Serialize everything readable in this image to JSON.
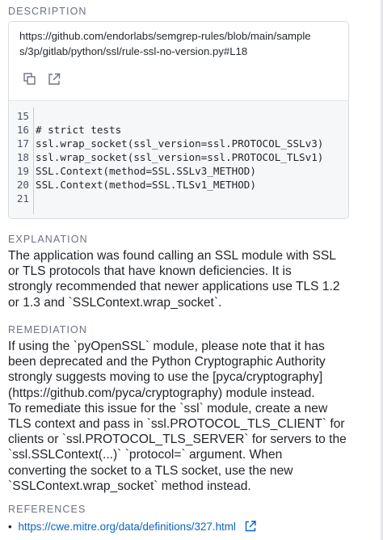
{
  "description": {
    "heading": "DESCRIPTION",
    "url_lines": [
      "https://github.com/endorlabs/semgrep-rules/blob/main/sample",
      "s/3p/gitlab/python/ssl/rule-ssl-no-version.py#L18"
    ],
    "actions": {
      "copy_icon": "copy-icon",
      "open_icon": "external-link-icon"
    },
    "code_lines": [
      {
        "no": "15",
        "code": ""
      },
      {
        "no": "16",
        "code": "# strict tests"
      },
      {
        "no": "17",
        "code": "ssl.wrap_socket(ssl_version=ssl.PROTOCOL_SSLv3)"
      },
      {
        "no": "18",
        "code": "ssl.wrap_socket(ssl_version=ssl.PROTOCOL_TLSv1)"
      },
      {
        "no": "19",
        "code": "SSL.Context(method=SSL.SSLv3_METHOD)"
      },
      {
        "no": "20",
        "code": "SSL.Context(method=SSL.TLSv1_METHOD)"
      },
      {
        "no": "21",
        "code": ""
      }
    ]
  },
  "explanation": {
    "heading": "EXPLANATION",
    "lines": [
      "The application was found calling an SSL module with SSL",
      "or TLS protocols that have known deficiencies. It is",
      "strongly recommended that newer applications use TLS 1.2",
      "or 1.3 and `SSLContext.wrap_socket`."
    ]
  },
  "remediation": {
    "heading": "REMEDIATION",
    "lines": [
      "If using the `pyOpenSSL` module, please note that it has",
      "been deprecated and the Python Cryptographic Authority",
      "strongly suggests moving to use the [pyca/cryptography]",
      "(https://github.com/pyca/cryptography) module instead.",
      "To remediate this issue for the `ssl` module, create a new",
      "TLS context and pass in `ssl.PROTOCOL_TLS_CLIENT` for",
      "clients or `ssl.PROTOCOL_TLS_SERVER` for servers to the",
      "`ssl.SSLContext(...)` `protocol=` argument. When",
      "converting the socket to a TLS socket, use the new",
      "`SSLContext.wrap_socket` method instead."
    ]
  },
  "references": {
    "heading": "REFERENCES",
    "items": [
      {
        "bullet": "•",
        "label": "https://cwe.mitre.org/data/definitions/327.html",
        "icon": "external-link-icon"
      }
    ]
  },
  "colors": {
    "link": "#0b63c9",
    "heading": "#6b7280",
    "code_bg": "#f6f7f9",
    "border": "#d8dbe0"
  }
}
